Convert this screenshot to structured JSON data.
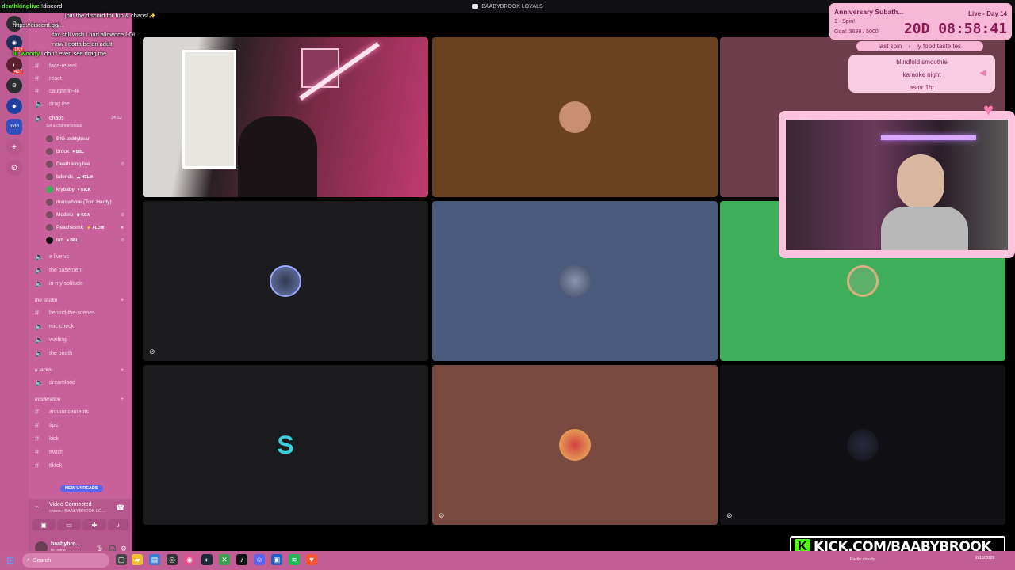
{
  "window": {
    "title": "BAABYBROOK LOYALS"
  },
  "chat_overlay": [
    {
      "user": "deathkinglive",
      "msg": "!discord"
    },
    {
      "user": "",
      "msg": "join the discord for fun & chaos!✨"
    },
    {
      "user": "",
      "msg": "https://discord.gg/..."
    },
    {
      "user": "",
      "msg": "fax still wish I had allownce LOL"
    },
    {
      "user": "",
      "msg": "now I gotta be an adult"
    },
    {
      "user": "lil_woody",
      "msg": "i don't even see drag me"
    }
  ],
  "rail": {
    "badges": [
      "1K+",
      "427"
    ],
    "mod_label": "mdd"
  },
  "sidebar": {
    "channels_top": [
      "face-reveal",
      "react",
      "caught-in-4k",
      "drag me"
    ],
    "voice_channel": {
      "name": "chaos",
      "time": "34:32",
      "subtitle": "Set a channel status"
    },
    "voice_users": [
      {
        "name": "BIG teddybear",
        "tag": ""
      },
      {
        "name": "brook",
        "tag": "♥ BBL"
      },
      {
        "name": "Death king live",
        "tag": ""
      },
      {
        "name": "bdends",
        "tag": "☁ HELM"
      },
      {
        "name": "krybaby",
        "tag": "♥ KICK"
      },
      {
        "name": "man whore (Tom Hardy)",
        "tag": ""
      },
      {
        "name": "Modelo",
        "tag": "♛ KOA"
      },
      {
        "name": "Peachesmk",
        "tag": "⚡ FLOW"
      },
      {
        "name": "tutt",
        "tag": "♥ BBL"
      }
    ],
    "channels_mid": [
      "e live vc",
      "the basement",
      "in my solitude"
    ],
    "category_studio": "the studio",
    "channels_studio": [
      "behind-the-scenes",
      "mic check",
      "waiting",
      "the booth"
    ],
    "category_lackin": "u lackin",
    "channels_lackin": [
      "dreamland"
    ],
    "category_mod": "moderation",
    "channels_mod": [
      "announcements",
      "tips",
      "kick",
      "twitch",
      "tiktok"
    ],
    "new_unreads": "NEW UNREADS",
    "voice_panel": {
      "status": "Video Connected",
      "location": "chaos / BAABYBROOK LO..."
    },
    "user_panel": {
      "name": "baabybro...",
      "status": "In voice"
    }
  },
  "tiles": [
    {
      "id": "tile-1",
      "bg": "#3a2a30",
      "kind": "video"
    },
    {
      "id": "tile-2",
      "bg": "#6b4220",
      "kind": "avatar"
    },
    {
      "id": "tile-3",
      "bg": "#6e3d4c",
      "kind": "video"
    },
    {
      "id": "tile-4",
      "bg": "#1b1b1e",
      "kind": "avatar"
    },
    {
      "id": "tile-5",
      "bg": "#4a5a7c",
      "kind": "avatar"
    },
    {
      "id": "tile-6",
      "bg": "#3fae5a",
      "kind": "avatar"
    },
    {
      "id": "tile-7",
      "bg": "#1b1b1e",
      "kind": "avatar"
    },
    {
      "id": "tile-8",
      "bg": "#7a4a40",
      "kind": "avatar"
    },
    {
      "id": "tile-9",
      "bg": "#111115",
      "kind": "avatar"
    }
  ],
  "subathon": {
    "title": "Anniversary Subath...",
    "live": "Live - Day 14",
    "spin": "1 - Spin!",
    "goal": "Goal: 3698 / 5000",
    "timer": "20D 08:58:41"
  },
  "last_spin": {
    "label": "last spin",
    "value": "ly food taste tes"
  },
  "wheel_items": [
    "blindfold smoothie",
    "karaoke night",
    "asmr 1hr"
  ],
  "kick_banner": "KICK.COM/BAABYBROOK",
  "taskbar": {
    "search": "Search",
    "weather": "Partly cloudy",
    "date": "2/15/2026"
  }
}
